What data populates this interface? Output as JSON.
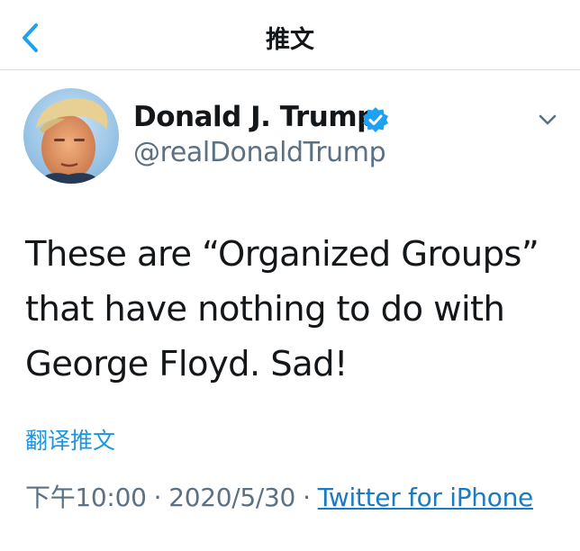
{
  "header": {
    "title": "推文",
    "back_icon": "chevron-left-icon"
  },
  "tweet": {
    "display_name": "Donald J. Trump",
    "handle": "@realDonaldTrump",
    "text": "These are “Organized Groups” that have nothing to do with George Floyd. Sad!",
    "translate_label": "翻译推文",
    "time": "下午10:00",
    "date": "2020/5/30",
    "separator": "·",
    "source": "Twitter for iPhone"
  },
  "colors": {
    "accent": "#1b95e0",
    "verified": "#1da1f2",
    "secondary_text": "#5b7083"
  }
}
